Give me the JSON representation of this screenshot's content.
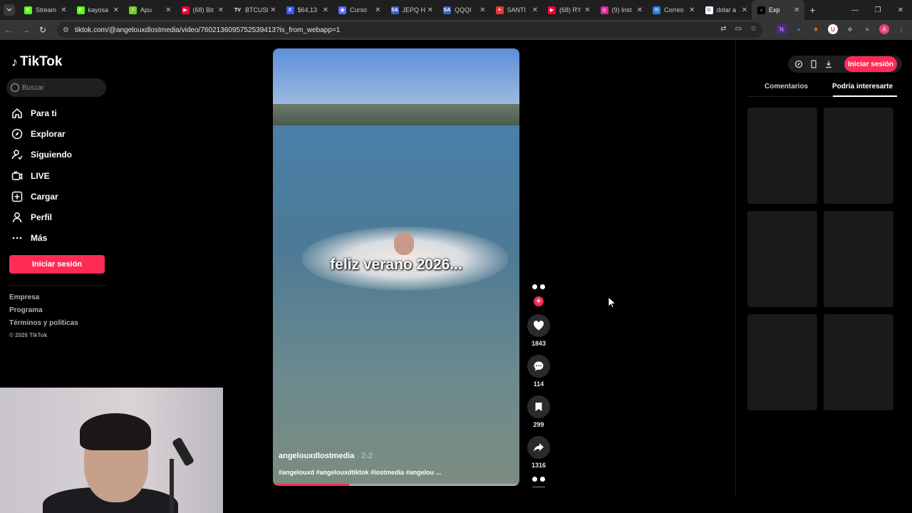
{
  "browser": {
    "tabs": [
      {
        "title": "Stream",
        "fav_color": "#53fc18",
        "fav_text": "K"
      },
      {
        "title": "kayosa",
        "fav_color": "#53fc18",
        "fav_text": "K"
      },
      {
        "title": "Apu",
        "fav_color": "#74d12a",
        "fav_text": "/"
      },
      {
        "title": "(68) Bit",
        "fav_color": "#ff0033",
        "fav_text": "▶"
      },
      {
        "title": "BTCUSD",
        "fav_color": "#222222",
        "fav_text": "TV"
      },
      {
        "title": "$64,13",
        "fav_color": "#2f5cff",
        "fav_text": "X"
      },
      {
        "title": "Curso",
        "fav_color": "#5b6bff",
        "fav_text": "◉"
      },
      {
        "title": "JEPQ H",
        "fav_color": "#3a5ec8",
        "fav_text": "SA"
      },
      {
        "title": "QQQI",
        "fav_color": "#3a5ec8",
        "fav_text": "SA"
      },
      {
        "title": "SANTI",
        "fav_color": "#e23a3a",
        "fav_text": "✦"
      },
      {
        "title": "(68) RY",
        "fav_color": "#ff0033",
        "fav_text": "▶"
      },
      {
        "title": "(9) Inst",
        "fav_color": "#d6249f",
        "fav_text": "◎"
      },
      {
        "title": "Correo",
        "fav_color": "#2a7de1",
        "fav_text": "✉"
      },
      {
        "title": "dolar a",
        "fav_color": "#ffffff",
        "fav_text": "G"
      },
      {
        "title": "Exp",
        "fav_color": "#000000",
        "fav_text": "♪",
        "active": true
      }
    ],
    "url": "tiktok.com/@angelouxdlostmedia/video/7602136095752539413?is_from_webapp=1"
  },
  "sidebar": {
    "brand": "TikTok",
    "search_placeholder": "Buscar",
    "items": [
      {
        "label": "Para ti",
        "icon": "home-icon"
      },
      {
        "label": "Explorar",
        "icon": "compass-icon"
      },
      {
        "label": "Siguiendo",
        "icon": "following-icon"
      },
      {
        "label": "LIVE",
        "icon": "live-icon"
      },
      {
        "label": "Cargar",
        "icon": "upload-icon"
      },
      {
        "label": "Perfil",
        "icon": "profile-icon"
      },
      {
        "label": "Más",
        "icon": "more-icon"
      }
    ],
    "login_label": "Iniciar sesión",
    "footer": [
      "Empresa",
      "Programa",
      "Términos y políticas"
    ],
    "copyright": "© 2026 TikTok"
  },
  "video": {
    "caption": "feliz verano 2026...",
    "author": "angelouxdlostmedia",
    "date": "· 2-2",
    "tags": "#angelouxd #angelouxdtiktok #lostmedia #angelou ...",
    "progress": 0.31
  },
  "actions": {
    "likes": "1843",
    "comments": "114",
    "saves": "299",
    "shares": "1316"
  },
  "right_panel": {
    "login_label": "Iniciar sesión",
    "tabs": [
      "Comentarios",
      "Podría interesarte"
    ],
    "selected_tab": 1
  },
  "colors": {
    "accent": "#fe2c55"
  }
}
